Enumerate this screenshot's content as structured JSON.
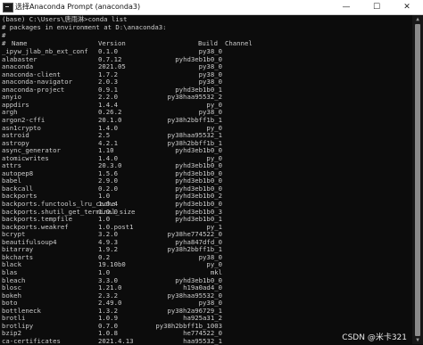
{
  "window": {
    "title": "选择Anaconda Prompt (anaconda3)",
    "minimize_glyph": "—",
    "maximize_glyph": "☐",
    "close_glyph": "✕",
    "icon": "terminal-icon"
  },
  "console": {
    "command_line": "(base) C:\\Users\\唐雨淋>conda list",
    "env_line": "# packages in environment at D:\\anaconda3:",
    "hash_line": "#",
    "header": {
      "hash": "#",
      "name": "Name",
      "version": "Version",
      "build": "Build",
      "channel": "Channel"
    },
    "packages": [
      {
        "name": "_ipyw_jlab_nb_ext_conf",
        "version": "0.1.0",
        "build": "py38_0"
      },
      {
        "name": "alabaster",
        "version": "0.7.12",
        "build": "pyhd3eb1b0_0"
      },
      {
        "name": "anaconda",
        "version": "2021.05",
        "build": "py38_0"
      },
      {
        "name": "anaconda-client",
        "version": "1.7.2",
        "build": "py38_0"
      },
      {
        "name": "anaconda-navigator",
        "version": "2.0.3",
        "build": "py38_0"
      },
      {
        "name": "anaconda-project",
        "version": "0.9.1",
        "build": "pyhd3eb1b0_1"
      },
      {
        "name": "anyio",
        "version": "2.2.0",
        "build": "py38haa95532_2"
      },
      {
        "name": "appdirs",
        "version": "1.4.4",
        "build": "py_0"
      },
      {
        "name": "argh",
        "version": "0.26.2",
        "build": "py38_0"
      },
      {
        "name": "argon2-cffi",
        "version": "20.1.0",
        "build": "py38h2bbff1b_1"
      },
      {
        "name": "asn1crypto",
        "version": "1.4.0",
        "build": "py_0"
      },
      {
        "name": "astroid",
        "version": "2.5",
        "build": "py38haa95532_1"
      },
      {
        "name": "astropy",
        "version": "4.2.1",
        "build": "py38h2bbff1b_1"
      },
      {
        "name": "async_generator",
        "version": "1.10",
        "build": "pyhd3eb1b0_0"
      },
      {
        "name": "atomicwrites",
        "version": "1.4.0",
        "build": "py_0"
      },
      {
        "name": "attrs",
        "version": "20.3.0",
        "build": "pyhd3eb1b0_0"
      },
      {
        "name": "autopep8",
        "version": "1.5.6",
        "build": "pyhd3eb1b0_0"
      },
      {
        "name": "babel",
        "version": "2.9.0",
        "build": "pyhd3eb1b0_0"
      },
      {
        "name": "backcall",
        "version": "0.2.0",
        "build": "pyhd3eb1b0_0"
      },
      {
        "name": "backports",
        "version": "1.0",
        "build": "pyhd3eb1b0_2"
      },
      {
        "name": "backports.functools_lru_cache",
        "version": "1.6.4",
        "build": "pyhd3eb1b0_0"
      },
      {
        "name": "backports.shutil_get_terminal_size",
        "version": "1.0.0",
        "build": "pyhd3eb1b0_3"
      },
      {
        "name": "backports.tempfile",
        "version": "1.0",
        "build": "pyhd3eb1b0_1"
      },
      {
        "name": "backports.weakref",
        "version": "1.0.post1",
        "build": "py_1"
      },
      {
        "name": "bcrypt",
        "version": "3.2.0",
        "build": "py38he774522_0"
      },
      {
        "name": "beautifulsoup4",
        "version": "4.9.3",
        "build": "pyha847dfd_0"
      },
      {
        "name": "bitarray",
        "version": "1.9.2",
        "build": "py38h2bbff1b_1"
      },
      {
        "name": "bkcharts",
        "version": "0.2",
        "build": "py38_0"
      },
      {
        "name": "black",
        "version": "19.10b0",
        "build": "py_0"
      },
      {
        "name": "blas",
        "version": "1.0",
        "build": "mkl"
      },
      {
        "name": "bleach",
        "version": "3.3.0",
        "build": "pyhd3eb1b0_0"
      },
      {
        "name": "blosc",
        "version": "1.21.0",
        "build": "h19a0ad4_0"
      },
      {
        "name": "bokeh",
        "version": "2.3.2",
        "build": "py38haa95532_0"
      },
      {
        "name": "boto",
        "version": "2.49.0",
        "build": "py38_0"
      },
      {
        "name": "bottleneck",
        "version": "1.3.2",
        "build": "py38h2a96729_1"
      },
      {
        "name": "brotli",
        "version": "1.0.9",
        "build": "ha925a31_2"
      },
      {
        "name": "brotlipy",
        "version": "0.7.0",
        "build": "py38h2bbff1b_1003"
      },
      {
        "name": "bzip2",
        "version": "1.0.8",
        "build": "he774522_0"
      },
      {
        "name": "ca-certificates",
        "version": "2021.4.13",
        "build": "haa95532_1"
      }
    ]
  },
  "watermark": "CSDN @米卡321"
}
